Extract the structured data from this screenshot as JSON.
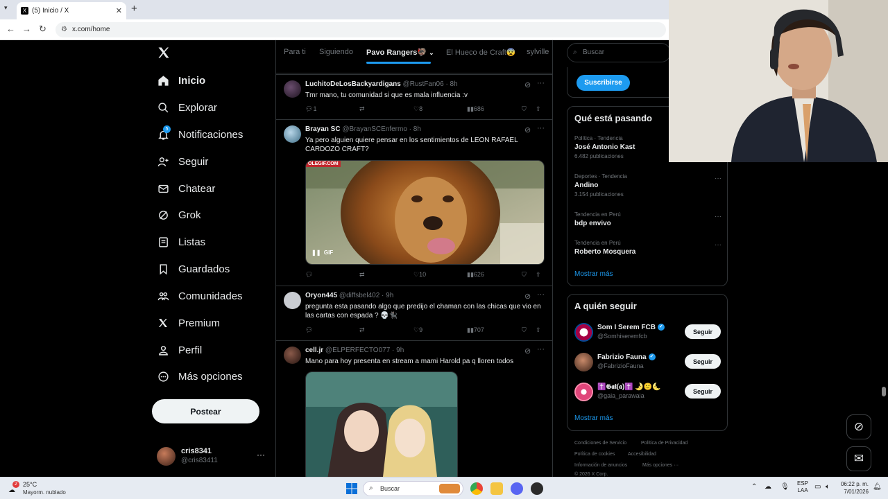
{
  "browser": {
    "tab_title": "(5) Inicio / X",
    "url": "x.com/home"
  },
  "nav": {
    "items": [
      {
        "label": "Inicio",
        "icon": "home-icon",
        "active": true
      },
      {
        "label": "Explorar",
        "icon": "search-icon"
      },
      {
        "label": "Notificaciones",
        "icon": "bell-icon",
        "badge": "5"
      },
      {
        "label": "Seguir",
        "icon": "person-add-icon"
      },
      {
        "label": "Chatear",
        "icon": "mail-icon"
      },
      {
        "label": "Grok",
        "icon": "grok-icon"
      },
      {
        "label": "Listas",
        "icon": "list-icon"
      },
      {
        "label": "Guardados",
        "icon": "bookmark-icon"
      },
      {
        "label": "Comunidades",
        "icon": "communities-icon"
      },
      {
        "label": "Premium",
        "icon": "x-logo-icon"
      },
      {
        "label": "Perfil",
        "icon": "person-icon"
      },
      {
        "label": "Más opciones",
        "icon": "more-circle-icon"
      }
    ],
    "post_label": "Postear",
    "account": {
      "name": "cris8341",
      "handle": "@cris83411"
    }
  },
  "feed_tabs": [
    "Para ti",
    "Siguiendo",
    "Pavo Rangers🦃",
    "El Hueco de Craft😨",
    "sylville"
  ],
  "tweets": [
    {
      "name": "LuchitoDeLosBackyardigans",
      "handle": "@RustFan06",
      "time": "· 8h",
      "text": "Tmr mano, tu comunidad si que es mala influencia :v",
      "replies": "1",
      "retweets": "",
      "likes": "8",
      "views": "686"
    },
    {
      "name": "Brayan SC",
      "handle": "@BrayanSCEnfermo",
      "time": "· 8h",
      "text": "Ya pero alguien quiere pensar en los sentimientos de LEON RAFAEL CARDOZO CRAFT?",
      "media_watermark": "OLEGIF.COM",
      "media_badge": "GIF",
      "replies": "",
      "retweets": "",
      "likes": "10",
      "views": "626"
    },
    {
      "name": "Oryon445",
      "handle": "@diffsbel402",
      "time": "· 9h",
      "text": "pregunta esta pasando algo que predijo el chaman con las chicas que vio en las cartas con espada ? 💀🐈‍⬛",
      "replies": "",
      "retweets": "",
      "likes": "9",
      "views": "707"
    },
    {
      "name": "cell.jr",
      "handle": "@ELPERFECTO077",
      "time": "· 9h",
      "text": "Mano para hoy presenta en stream a mami  Harold pa q lloren todos"
    }
  ],
  "right": {
    "search_placeholder": "Buscar",
    "subscribe_label": "Suscribirse",
    "trends_title": "Qué está pasando",
    "trends": [
      {
        "category": "Política · Tendencia",
        "name": "José Antonio Kast",
        "count": "6.482 publicaciones"
      },
      {
        "category": "Deportes · Tendencia",
        "name": "Andino",
        "count": "3.154 publicaciones"
      },
      {
        "category": "Tendencia en Perú",
        "name": "bdp envivo",
        "count": ""
      },
      {
        "category": "Tendencia en Perú",
        "name": "Roberto Mosquera",
        "count": ""
      }
    ],
    "show_more": "Mostrar más",
    "who_title": "A quién seguir",
    "who": [
      {
        "name": "Som I Serem FCB",
        "handle": "@Somhiseremfcb",
        "verified": true
      },
      {
        "name": "Fabrizio Fauna",
        "handle": "@FabrizioFauna",
        "verified": true
      },
      {
        "name": "✝️𝕲𝖆𝖎(𝖆)✝️ 🌛🙂🌜",
        "handle": "@gaia_parawaia",
        "verified": false
      }
    ],
    "follow_label": "Seguir",
    "footer": [
      "Condiciones de Servicio",
      "Política de Privacidad",
      "Política de cookies",
      "Accesibilidad",
      "Información de anuncios",
      "Más opciones ···",
      "© 2026 X Corp."
    ]
  },
  "taskbar": {
    "weather_temp": "25°C",
    "weather_desc": "Mayorm. nublado",
    "search_placeholder": "Buscar",
    "lang_top": "ESP",
    "lang_bottom": "LAA",
    "time": "06:22 p. m.",
    "date": "7/01/2026"
  },
  "colors": {
    "accent": "#1d9bf0",
    "background": "#000000",
    "muted": "#71767b"
  }
}
